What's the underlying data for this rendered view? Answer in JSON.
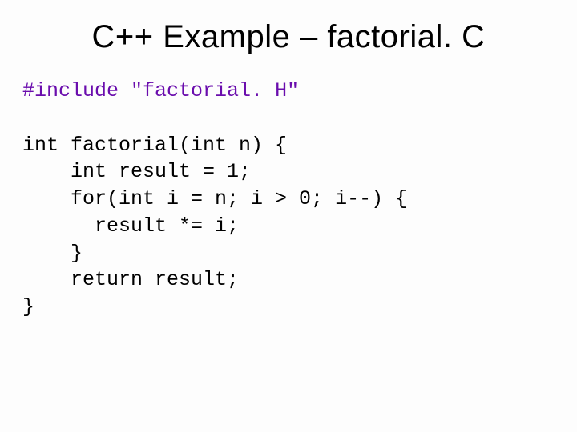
{
  "title": "C++ Example – factorial. C",
  "code": {
    "l1a": "#include",
    "l1b": " \"factorial. H\"",
    "blank1": "",
    "l2": "int factorial(int n) {",
    "l3": "    int result = 1;",
    "l4": "    for(int i = n; i > 0; i--) {",
    "l5": "      result *= i;",
    "l6": "    }",
    "l7": "    return result;",
    "l8": "}"
  }
}
